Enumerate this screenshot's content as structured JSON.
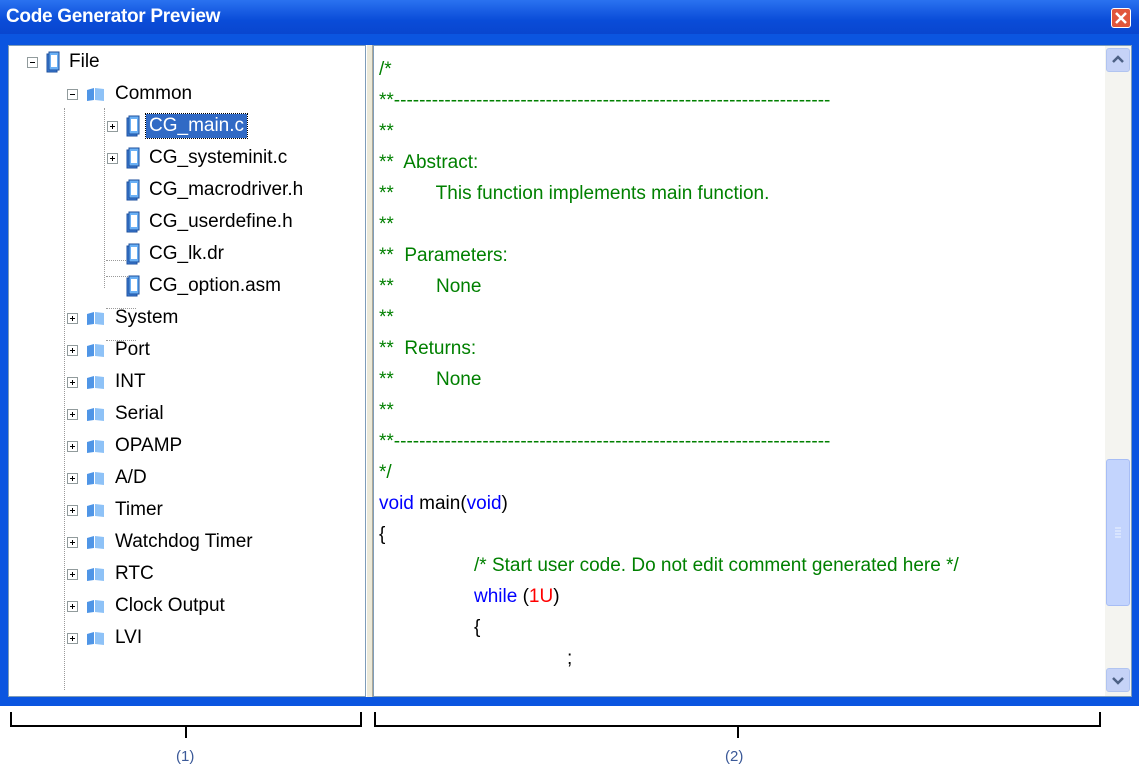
{
  "window": {
    "title": "Code Generator Preview",
    "close_icon": "close-icon"
  },
  "tree": {
    "root": {
      "label": "File",
      "icon": "file-icon",
      "expanded": true
    },
    "common": {
      "label": "Common",
      "icon": "folder-icon",
      "expanded": true
    },
    "common_files": [
      {
        "label": "CG_main.c",
        "has_children": true,
        "selected": true
      },
      {
        "label": "CG_systeminit.c",
        "has_children": true,
        "selected": false
      },
      {
        "label": "CG_macrodriver.h",
        "has_children": false,
        "selected": false
      },
      {
        "label": "CG_userdefine.h",
        "has_children": false,
        "selected": false
      },
      {
        "label": "CG_lk.dr",
        "has_children": false,
        "selected": false
      },
      {
        "label": "CG_option.asm",
        "has_children": false,
        "selected": false
      }
    ],
    "folders": [
      {
        "label": "System"
      },
      {
        "label": "Port"
      },
      {
        "label": "INT"
      },
      {
        "label": "Serial"
      },
      {
        "label": "OPAMP"
      },
      {
        "label": "A/D"
      },
      {
        "label": "Timer"
      },
      {
        "label": "Watchdog Timer"
      },
      {
        "label": "RTC"
      },
      {
        "label": "Clock Output"
      },
      {
        "label": "LVI"
      }
    ]
  },
  "code": {
    "lines": [
      "/*",
      "**---------------------------------------------------------------------",
      "**",
      "**  Abstract:",
      "**        This function implements main function.",
      "**",
      "**  Parameters:",
      "**        None",
      "**",
      "**  Returns:",
      "**        None",
      "**",
      "**---------------------------------------------------------------------",
      "*/"
    ],
    "void_kw": "void",
    "main_sig_a": " main(",
    "main_sig_b": ")",
    "open_brace": "{",
    "user_comment": "/* Start user code. Do not edit comment generated here */",
    "while_kw": "while",
    "while_a": " (",
    "while_num": "1U",
    "while_b": ")",
    "inner_brace": "{",
    "semicolon": ";"
  },
  "annotations": {
    "left": "(1)",
    "right": "(2)"
  },
  "colors": {
    "titlebar": "#0a4cd8",
    "comment": "#008000",
    "keyword": "#0000ff",
    "number": "#ff0000",
    "selection": "#316ac5"
  }
}
